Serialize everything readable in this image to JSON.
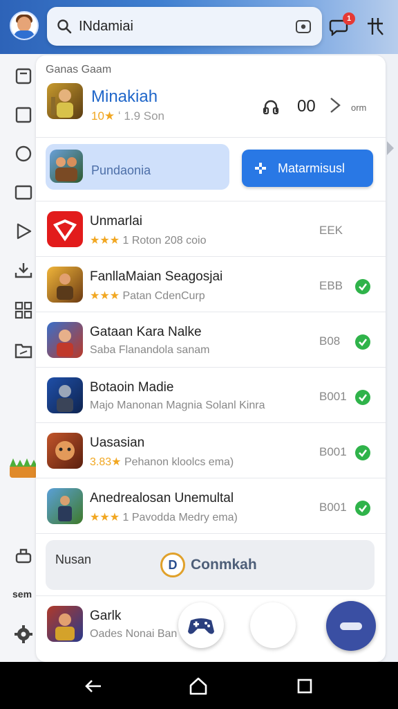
{
  "search": {
    "value": "INdamiai"
  },
  "notifications": {
    "badge": "1"
  },
  "section": {
    "title": "Ganas Gaam"
  },
  "featured": {
    "name": "Minakiah",
    "rating": "10★",
    "meta": "ʻ 1.9 Son",
    "count": "00",
    "tag": "orm"
  },
  "promo": {
    "label": "Pundaonia",
    "button": "Matarmisusl"
  },
  "list": [
    {
      "title": "Unmarlai",
      "rating": "★★★",
      "sub": "1 Roton 208 coio",
      "size": "EEK",
      "checked": false
    },
    {
      "title": "FanllaMaian Seagosjai",
      "rating": "★★★",
      "sub": "Patan CdenCurp",
      "size": "EBB",
      "checked": true
    },
    {
      "title": "Gataan Kara Nalke",
      "rating": "",
      "sub": "Saba Flanandola sanam",
      "size": "B08",
      "checked": true
    },
    {
      "title": "Botaoin Madie",
      "rating": "",
      "sub": "Majo Manonan Magnia Solanl Kinra",
      "size": "B001",
      "checked": true
    },
    {
      "title": "Uasasian",
      "rating": "3.83★",
      "sub": "Pehanon kloolcs ema)",
      "size": "B001",
      "checked": true
    },
    {
      "title": "Anedrealosan Unemultal",
      "rating": "★★★",
      "sub": "1 Pavodda Medry ema)",
      "size": "B001",
      "checked": true
    }
  ],
  "notice": {
    "label": "Nusan",
    "logo_letter": "D",
    "text": "Conmkah"
  },
  "last_row": {
    "title": "Garlk",
    "sub": "Oades Nonai Ban"
  },
  "rail_label": "sem",
  "colors": {
    "accent": "#2978e5",
    "check": "#2fb34a",
    "fab": "#3a4fa3",
    "badge": "#e53935"
  }
}
